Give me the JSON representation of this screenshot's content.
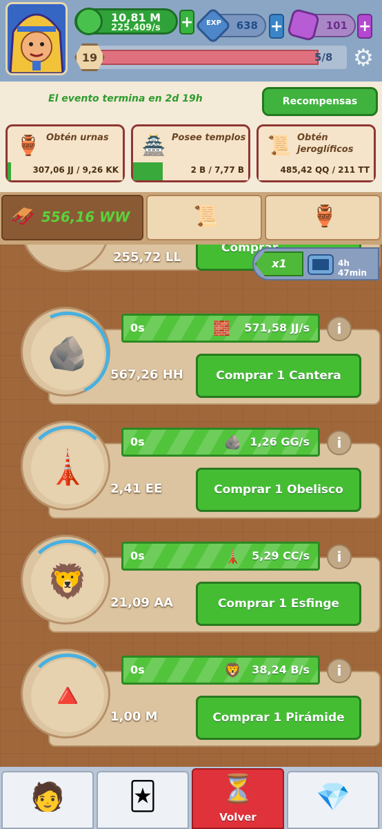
{
  "header": {
    "money": "10,81 M",
    "money_rate": "225.409/s",
    "exp_label": "EXP",
    "exp_value": "638",
    "gems": "101",
    "level": "19",
    "level_progress": "5/8",
    "plus": "+"
  },
  "event": {
    "ends_text": "El evento termina en 2d 19h",
    "rewards_label": "Recompensas",
    "quests": [
      {
        "title": "Obtén urnas",
        "progress": "307,06 JJ / 9,26 KK",
        "fraction": 0.03
      },
      {
        "title": "Posee templos",
        "progress": "2 B / 7,77 B",
        "fraction": 0.26
      },
      {
        "title": "Obtén jeroglíficos",
        "progress": "485,42 QQ / 211 TT",
        "fraction": 0.0
      }
    ]
  },
  "tabs": {
    "resource_value": "556,16 WW"
  },
  "multiplier": {
    "label": "x1",
    "timer": "4h 47min"
  },
  "producers": [
    {
      "cost": "255,72 LL",
      "buy": "Comprar",
      "progress": 0
    },
    {
      "name": "Cantera",
      "time": "0s",
      "rate": "571,58 JJ/s",
      "cost": "567,26 HH",
      "buy": "Comprar 1 Cantera",
      "progress": 0.35
    },
    {
      "name": "Obelisco",
      "time": "0s",
      "rate": "1,26 GG/s",
      "cost": "2,41 EE",
      "buy": "Comprar 1 Obelisco",
      "progress": 0.15
    },
    {
      "name": "Esfinge",
      "time": "0s",
      "rate": "5,29 CC/s",
      "cost": "21,09 AA",
      "buy": "Comprar 1 Esfinge",
      "progress": 0.15
    },
    {
      "name": "Pirámide",
      "time": "0s",
      "rate": "38,24 B/s",
      "cost": "1,00 M",
      "buy": "Comprar 1 Pirámide",
      "progress": 0.12
    }
  ],
  "info_label": "i",
  "nav": {
    "back_label": "Volver"
  },
  "colors": {
    "accent_green": "#45bd33",
    "progress_blue": "#48b0e0",
    "nav_active": "#e0323a"
  }
}
